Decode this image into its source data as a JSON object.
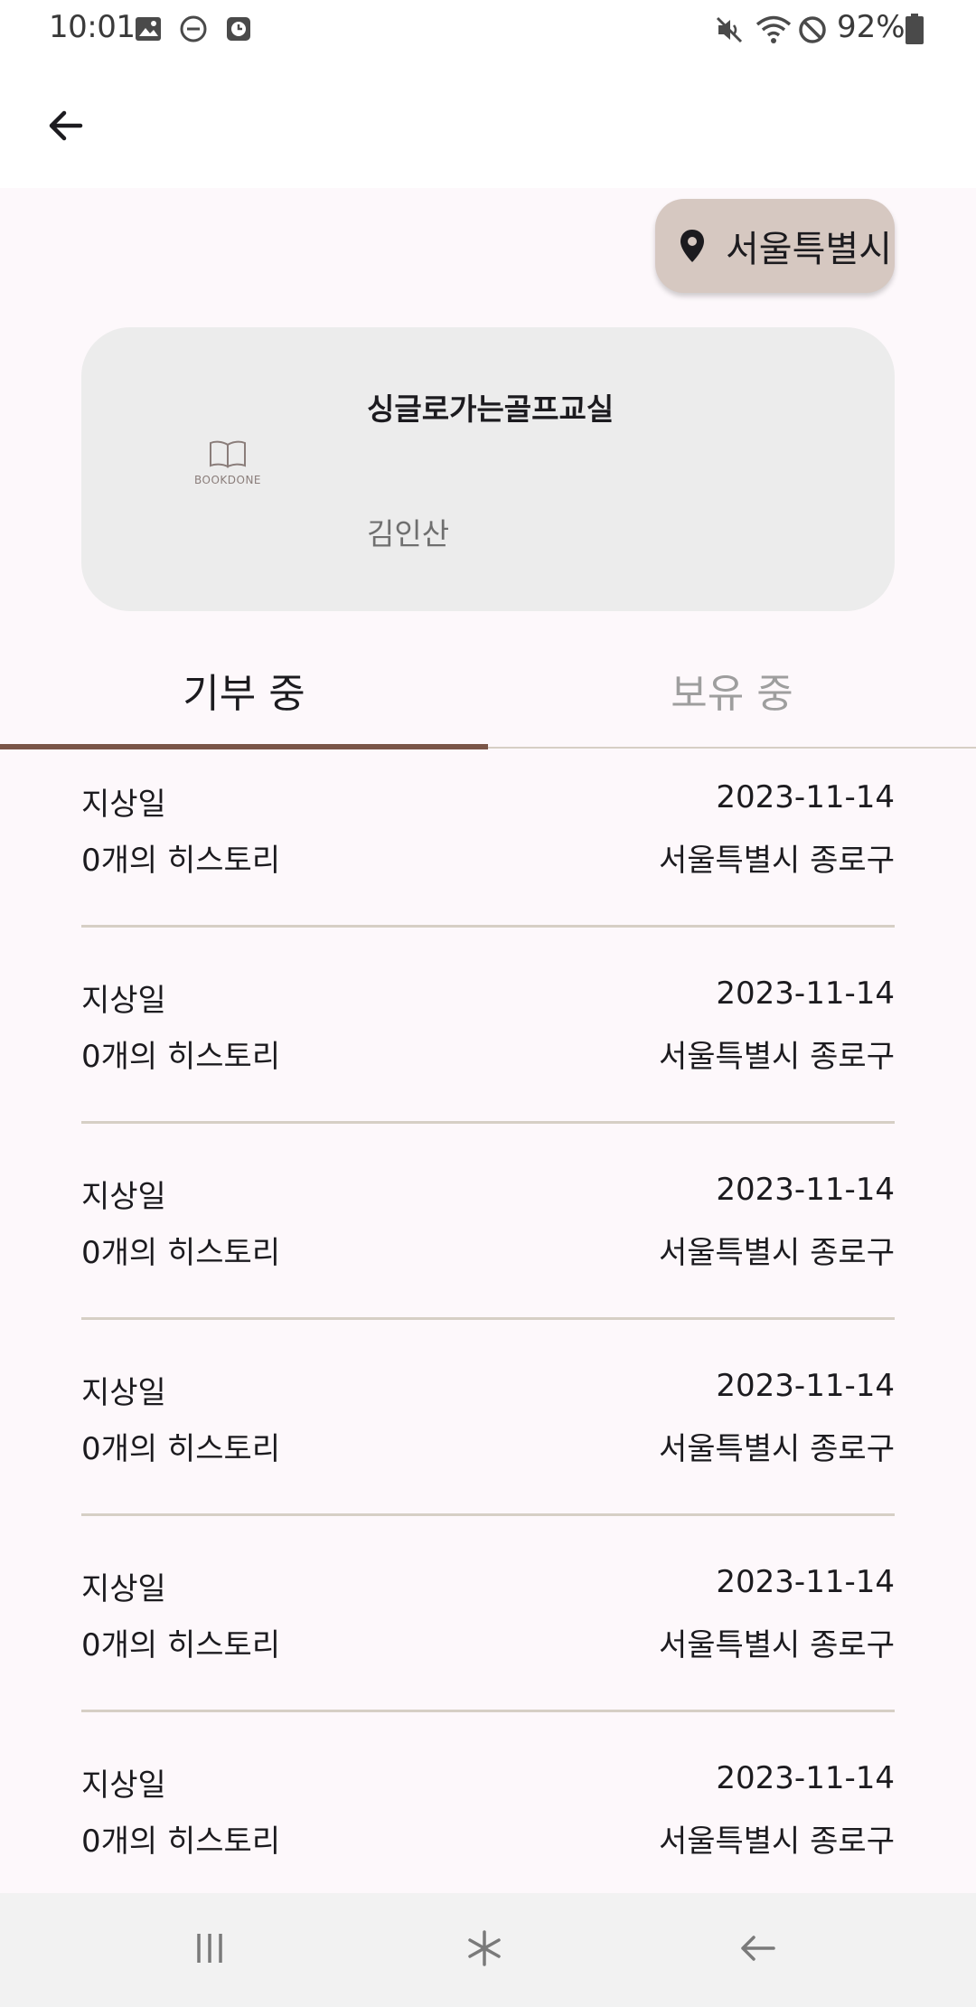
{
  "status_bar": {
    "time": "10:01",
    "battery": "92%",
    "icons": [
      "image-icon",
      "dnd-icon",
      "clock-app-icon",
      "mute-icon",
      "wifi-icon",
      "blocked-icon",
      "battery-icon"
    ]
  },
  "app_bar": {
    "back_icon": "arrow-back-icon"
  },
  "location_chip": {
    "icon": "location-pin-icon",
    "label": "서울특별시"
  },
  "book": {
    "title": "싱글로가는골프교실",
    "author": "김인산",
    "logo_text": "BOOKDONE"
  },
  "tabs": [
    {
      "label": "기부 중",
      "selected": true
    },
    {
      "label": "보유 중",
      "selected": false
    }
  ],
  "colors": {
    "accent": "#7a5548",
    "chip": "#d6c8c1",
    "background": "#fdf8fb",
    "card": "#ececec"
  },
  "items": [
    {
      "name": "지상일",
      "date": "2023-11-14",
      "history": "0개의 히스토리",
      "location": "서울특별시 종로구"
    },
    {
      "name": "지상일",
      "date": "2023-11-14",
      "history": "0개의 히스토리",
      "location": "서울특별시 종로구"
    },
    {
      "name": "지상일",
      "date": "2023-11-14",
      "history": "0개의 히스토리",
      "location": "서울특별시 종로구"
    },
    {
      "name": "지상일",
      "date": "2023-11-14",
      "history": "0개의 히스토리",
      "location": "서울특별시 종로구"
    },
    {
      "name": "지상일",
      "date": "2023-11-14",
      "history": "0개의 히스토리",
      "location": "서울특별시 종로구"
    },
    {
      "name": "지상일",
      "date": "2023-11-14",
      "history": "0개의 히스토리",
      "location": "서울특별시 종로구"
    }
  ],
  "nav_bar": {
    "icons": [
      "recent-apps-icon",
      "home-icon",
      "back-nav-icon"
    ]
  }
}
